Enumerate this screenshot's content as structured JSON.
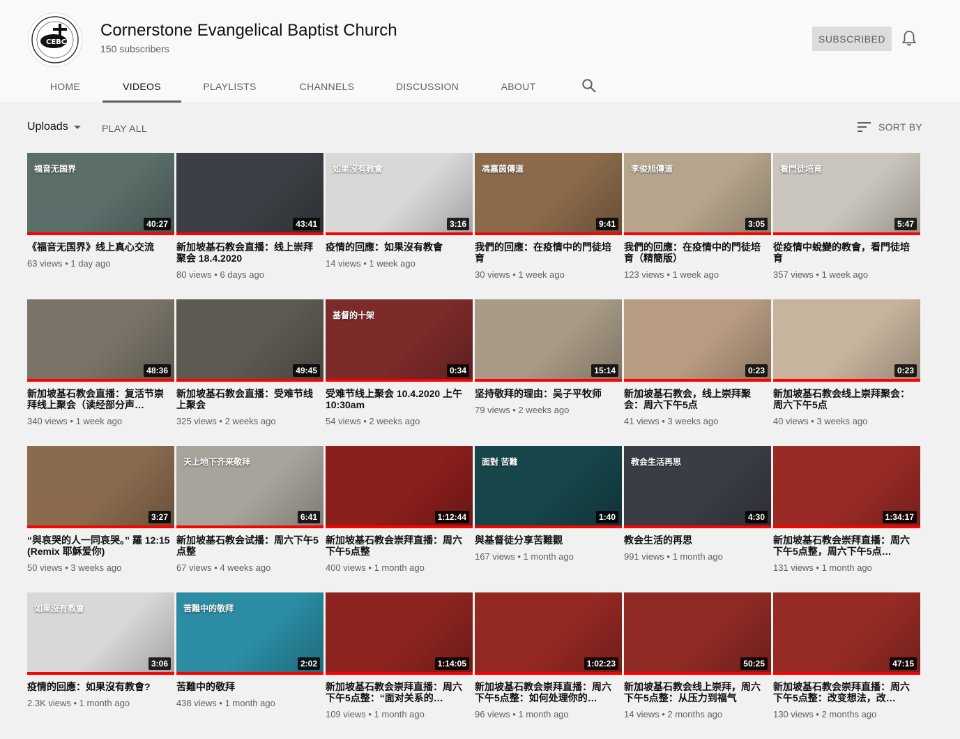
{
  "channel": {
    "name": "Cornerstone Evangelical Baptist Church",
    "subscribers": "150 subscribers",
    "subscribe_label": "SUBSCRIBED"
  },
  "tabs": [
    "HOME",
    "VIDEOS",
    "PLAYLISTS",
    "CHANNELS",
    "DISCUSSION",
    "ABOUT"
  ],
  "active_tab": "VIDEOS",
  "toolbar": {
    "uploads_label": "Uploads",
    "play_all": "PLAY ALL",
    "sort_by": "SORT BY"
  },
  "videos": [
    {
      "title": "《福音无国界》线上真心交流",
      "views": "63 views",
      "age": "1 day ago",
      "duration": "40:27",
      "overlay": "福音无国界",
      "bg": "#5b6e6a"
    },
    {
      "title": "新加坡基石教会直播：线上崇拜聚会 18.4.2020",
      "views": "80 views",
      "age": "6 days ago",
      "duration": "43:41",
      "overlay": "",
      "bg": "#3c3f45"
    },
    {
      "title": "疫情的回應：如果沒有教會",
      "views": "14 views",
      "age": "1 week ago",
      "duration": "3:16",
      "overlay": "如果沒有教會",
      "bg": "#d8d8d8"
    },
    {
      "title": "我們的回應：在疫情中的門徒培育",
      "views": "30 views",
      "age": "1 week ago",
      "duration": "9:41",
      "overlay": "馮嘉茵傳道",
      "bg": "#8a6a4a"
    },
    {
      "title": "我們的回應：在疫情中的門徒培育（精簡版）",
      "views": "123 views",
      "age": "1 week ago",
      "duration": "3:05",
      "overlay": "李俊旭傳道",
      "bg": "#b6a58c"
    },
    {
      "title": "從疫情中蛻變的教會，看門徒培育",
      "views": "357 views",
      "age": "1 week ago",
      "duration": "5:47",
      "overlay": "看門徒培育",
      "bg": "#c9c4bc"
    },
    {
      "title": "新加坡基石教会直播：复活节崇拜线上聚会（读经部分声…",
      "views": "340 views",
      "age": "1 week ago",
      "duration": "48:36",
      "overlay": "",
      "bg": "#7a7468"
    },
    {
      "title": "新加坡基石教会直播：受难节线上聚会",
      "views": "325 views",
      "age": "2 weeks ago",
      "duration": "49:45",
      "overlay": "",
      "bg": "#5d5a52"
    },
    {
      "title": "受难节线上聚会 10.4.2020 上午 10:30am",
      "views": "54 views",
      "age": "2 weeks ago",
      "duration": "0:34",
      "overlay": "基督的十架",
      "bg": "#7d2a2a"
    },
    {
      "title": "坚持敬拜的理由：吴子平牧师",
      "views": "79 views",
      "age": "2 weeks ago",
      "duration": "15:14",
      "overlay": "",
      "bg": "#a89a86"
    },
    {
      "title": "新加坡基石教会，线上崇拜聚会：周六下午5点",
      "views": "41 views",
      "age": "3 weeks ago",
      "duration": "0:23",
      "overlay": "",
      "bg": "#b89c82"
    },
    {
      "title": "新加坡基石教会线上崇拜聚会：周六下午5点",
      "views": "40 views",
      "age": "3 weeks ago",
      "duration": "0:23",
      "overlay": "",
      "bg": "#c7b49e"
    },
    {
      "title": "“與哀哭的人一同哀哭。” 羅 12:15 (Remix 耶穌爱你)",
      "views": "50 views",
      "age": "3 weeks ago",
      "duration": "3:27",
      "overlay": "",
      "bg": "#8a6b4e"
    },
    {
      "title": "新加坡基石教会试播：周六下午5点整",
      "views": "67 views",
      "age": "4 weeks ago",
      "duration": "6:41",
      "overlay": "天上地下齐来敬拜",
      "bg": "#a7a49b"
    },
    {
      "title": "新加坡基石教会崇拜直播：周六下午5点整",
      "views": "400 views",
      "age": "1 month ago",
      "duration": "1:12:44",
      "overlay": "",
      "bg": "#8b1f1c"
    },
    {
      "title": "與基督徒分享苦難觀",
      "views": "167 views",
      "age": "1 month ago",
      "duration": "1:40",
      "overlay": "面對 苦難",
      "bg": "#16454a"
    },
    {
      "title": "教会生活的再思",
      "views": "991 views",
      "age": "1 month ago",
      "duration": "4:30",
      "overlay": "教会生活再思",
      "bg": "#3a3d44"
    },
    {
      "title": "新加坡基石教会崇拜直播：周六下午5点整，周六下午5点…",
      "views": "131 views",
      "age": "1 month ago",
      "duration": "1:34:17",
      "overlay": "",
      "bg": "#9a2a25"
    },
    {
      "title": "疫情的回應：如果沒有教會?",
      "views": "2.3K views",
      "age": "1 month ago",
      "duration": "3:06",
      "overlay": "如果沒有教會",
      "bg": "#d8d8d8"
    },
    {
      "title": "苦難中的敬拜",
      "views": "438 views",
      "age": "1 month ago",
      "duration": "2:02",
      "overlay": "苦難中的敬拜",
      "bg": "#2b8ca3"
    },
    {
      "title": "新加坡基石教会崇拜直播：周六下午5点整：“面对关系的…",
      "views": "109 views",
      "age": "1 month ago",
      "duration": "1:14:05",
      "overlay": "",
      "bg": "#8e2420"
    },
    {
      "title": "新加坡基石教会崇拜直播：周六下午5点整：如何处理你的…",
      "views": "96 views",
      "age": "1 month ago",
      "duration": "1:02:23",
      "overlay": "",
      "bg": "#942823"
    },
    {
      "title": "新加坡基石教会线上崇拜，周六下午5点整：从压力到福气",
      "views": "14 views",
      "age": "2 months ago",
      "duration": "50:25",
      "overlay": "",
      "bg": "#8f2a24"
    },
    {
      "title": "新加坡基石教会崇拜直播：周六下午5点整：改变想法，改…",
      "views": "130 views",
      "age": "2 months ago",
      "duration": "47:15",
      "overlay": "",
      "bg": "#962b25"
    }
  ]
}
